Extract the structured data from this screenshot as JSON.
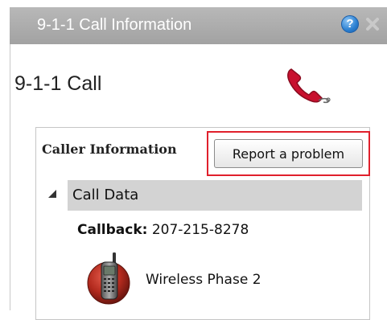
{
  "window": {
    "title": "9-1-1 Call Information",
    "help_icon": "help-icon",
    "help_glyph": "?",
    "close_icon": "close-icon"
  },
  "call": {
    "heading": "9-1-1 Call",
    "phone_icon": "phone-handset-icon"
  },
  "caller_info": {
    "title": "Caller Information",
    "report_button_label": "Report a problem",
    "highlight_color": "#e0202c",
    "section": {
      "title": "Call Data",
      "expanded": true,
      "callback_label": "Callback:",
      "callback_number": "207-215-8278",
      "connection_icon": "wireless-phone-icon",
      "connection_type": "Wireless Phase 2"
    }
  },
  "colors": {
    "titlebar": "#a2a2a2",
    "section_header": "#d3d3d3",
    "help_blue": "#2a7fd1",
    "phone_red": "#c8102e"
  }
}
